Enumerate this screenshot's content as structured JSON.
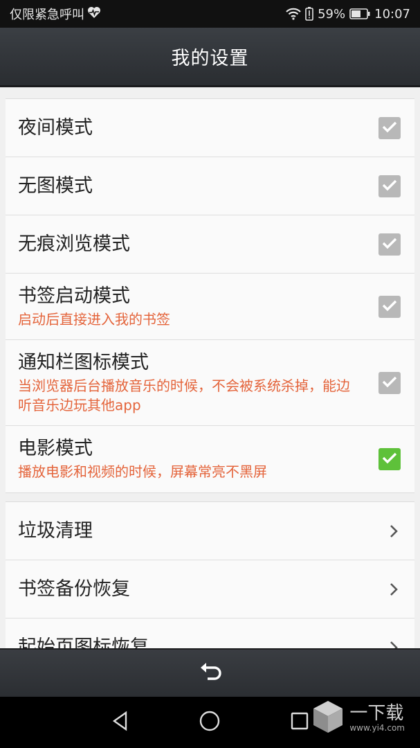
{
  "status_bar": {
    "carrier_text": "仅限紧急呼叫",
    "battery_percent": "59%",
    "time": "10:07",
    "icons": [
      "heart-pulse-icon",
      "wifi-icon",
      "battery-alert-icon",
      "battery-icon"
    ]
  },
  "header": {
    "title": "我的设置"
  },
  "settings": {
    "toggles": [
      {
        "label": "夜间模式",
        "subtitle": "",
        "checked": false
      },
      {
        "label": "无图模式",
        "subtitle": "",
        "checked": false
      },
      {
        "label": "无痕浏览模式",
        "subtitle": "",
        "checked": false
      },
      {
        "label": "书签启动模式",
        "subtitle": "启动后直接进入我的书签",
        "checked": false
      },
      {
        "label": "通知栏图标模式",
        "subtitle": "当浏览器后台播放音乐的时候，不会被系统杀掉，能边听音乐边玩其他app",
        "checked": false
      },
      {
        "label": "电影模式",
        "subtitle": "播放电影和视频的时候，屏幕常亮不黑屏",
        "checked": true
      }
    ],
    "links": [
      {
        "label": "垃圾清理"
      },
      {
        "label": "书签备份恢复"
      },
      {
        "label": "起始页图标恢复"
      }
    ]
  },
  "colors": {
    "accent_checked": "#5ec13a",
    "unchecked": "#b8b8b8",
    "subtitle": "#e4643b"
  },
  "watermark": {
    "brand": "一下载",
    "url": "www.yi4.com"
  }
}
